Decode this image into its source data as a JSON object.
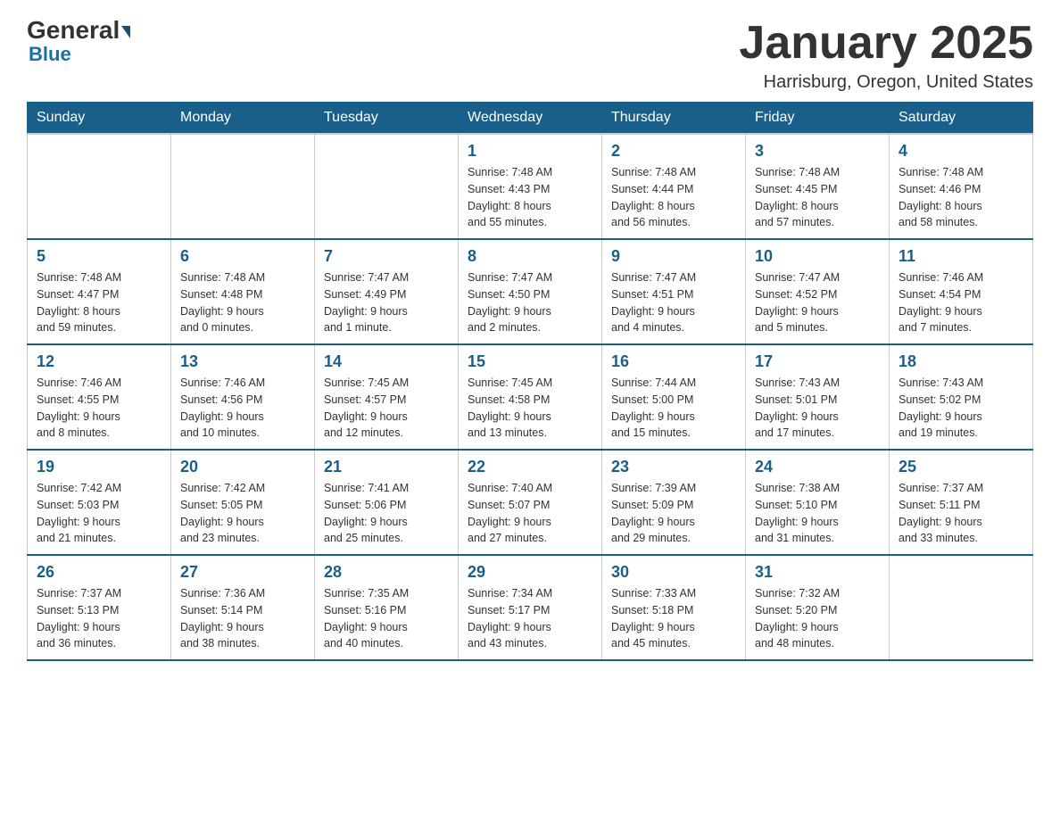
{
  "header": {
    "logo_general": "General",
    "logo_blue": "Blue",
    "month_title": "January 2025",
    "location": "Harrisburg, Oregon, United States"
  },
  "days_of_week": [
    "Sunday",
    "Monday",
    "Tuesday",
    "Wednesday",
    "Thursday",
    "Friday",
    "Saturday"
  ],
  "weeks": [
    [
      {
        "day": "",
        "info": ""
      },
      {
        "day": "",
        "info": ""
      },
      {
        "day": "",
        "info": ""
      },
      {
        "day": "1",
        "info": "Sunrise: 7:48 AM\nSunset: 4:43 PM\nDaylight: 8 hours\nand 55 minutes."
      },
      {
        "day": "2",
        "info": "Sunrise: 7:48 AM\nSunset: 4:44 PM\nDaylight: 8 hours\nand 56 minutes."
      },
      {
        "day": "3",
        "info": "Sunrise: 7:48 AM\nSunset: 4:45 PM\nDaylight: 8 hours\nand 57 minutes."
      },
      {
        "day": "4",
        "info": "Sunrise: 7:48 AM\nSunset: 4:46 PM\nDaylight: 8 hours\nand 58 minutes."
      }
    ],
    [
      {
        "day": "5",
        "info": "Sunrise: 7:48 AM\nSunset: 4:47 PM\nDaylight: 8 hours\nand 59 minutes."
      },
      {
        "day": "6",
        "info": "Sunrise: 7:48 AM\nSunset: 4:48 PM\nDaylight: 9 hours\nand 0 minutes."
      },
      {
        "day": "7",
        "info": "Sunrise: 7:47 AM\nSunset: 4:49 PM\nDaylight: 9 hours\nand 1 minute."
      },
      {
        "day": "8",
        "info": "Sunrise: 7:47 AM\nSunset: 4:50 PM\nDaylight: 9 hours\nand 2 minutes."
      },
      {
        "day": "9",
        "info": "Sunrise: 7:47 AM\nSunset: 4:51 PM\nDaylight: 9 hours\nand 4 minutes."
      },
      {
        "day": "10",
        "info": "Sunrise: 7:47 AM\nSunset: 4:52 PM\nDaylight: 9 hours\nand 5 minutes."
      },
      {
        "day": "11",
        "info": "Sunrise: 7:46 AM\nSunset: 4:54 PM\nDaylight: 9 hours\nand 7 minutes."
      }
    ],
    [
      {
        "day": "12",
        "info": "Sunrise: 7:46 AM\nSunset: 4:55 PM\nDaylight: 9 hours\nand 8 minutes."
      },
      {
        "day": "13",
        "info": "Sunrise: 7:46 AM\nSunset: 4:56 PM\nDaylight: 9 hours\nand 10 minutes."
      },
      {
        "day": "14",
        "info": "Sunrise: 7:45 AM\nSunset: 4:57 PM\nDaylight: 9 hours\nand 12 minutes."
      },
      {
        "day": "15",
        "info": "Sunrise: 7:45 AM\nSunset: 4:58 PM\nDaylight: 9 hours\nand 13 minutes."
      },
      {
        "day": "16",
        "info": "Sunrise: 7:44 AM\nSunset: 5:00 PM\nDaylight: 9 hours\nand 15 minutes."
      },
      {
        "day": "17",
        "info": "Sunrise: 7:43 AM\nSunset: 5:01 PM\nDaylight: 9 hours\nand 17 minutes."
      },
      {
        "day": "18",
        "info": "Sunrise: 7:43 AM\nSunset: 5:02 PM\nDaylight: 9 hours\nand 19 minutes."
      }
    ],
    [
      {
        "day": "19",
        "info": "Sunrise: 7:42 AM\nSunset: 5:03 PM\nDaylight: 9 hours\nand 21 minutes."
      },
      {
        "day": "20",
        "info": "Sunrise: 7:42 AM\nSunset: 5:05 PM\nDaylight: 9 hours\nand 23 minutes."
      },
      {
        "day": "21",
        "info": "Sunrise: 7:41 AM\nSunset: 5:06 PM\nDaylight: 9 hours\nand 25 minutes."
      },
      {
        "day": "22",
        "info": "Sunrise: 7:40 AM\nSunset: 5:07 PM\nDaylight: 9 hours\nand 27 minutes."
      },
      {
        "day": "23",
        "info": "Sunrise: 7:39 AM\nSunset: 5:09 PM\nDaylight: 9 hours\nand 29 minutes."
      },
      {
        "day": "24",
        "info": "Sunrise: 7:38 AM\nSunset: 5:10 PM\nDaylight: 9 hours\nand 31 minutes."
      },
      {
        "day": "25",
        "info": "Sunrise: 7:37 AM\nSunset: 5:11 PM\nDaylight: 9 hours\nand 33 minutes."
      }
    ],
    [
      {
        "day": "26",
        "info": "Sunrise: 7:37 AM\nSunset: 5:13 PM\nDaylight: 9 hours\nand 36 minutes."
      },
      {
        "day": "27",
        "info": "Sunrise: 7:36 AM\nSunset: 5:14 PM\nDaylight: 9 hours\nand 38 minutes."
      },
      {
        "day": "28",
        "info": "Sunrise: 7:35 AM\nSunset: 5:16 PM\nDaylight: 9 hours\nand 40 minutes."
      },
      {
        "day": "29",
        "info": "Sunrise: 7:34 AM\nSunset: 5:17 PM\nDaylight: 9 hours\nand 43 minutes."
      },
      {
        "day": "30",
        "info": "Sunrise: 7:33 AM\nSunset: 5:18 PM\nDaylight: 9 hours\nand 45 minutes."
      },
      {
        "day": "31",
        "info": "Sunrise: 7:32 AM\nSunset: 5:20 PM\nDaylight: 9 hours\nand 48 minutes."
      },
      {
        "day": "",
        "info": ""
      }
    ]
  ]
}
